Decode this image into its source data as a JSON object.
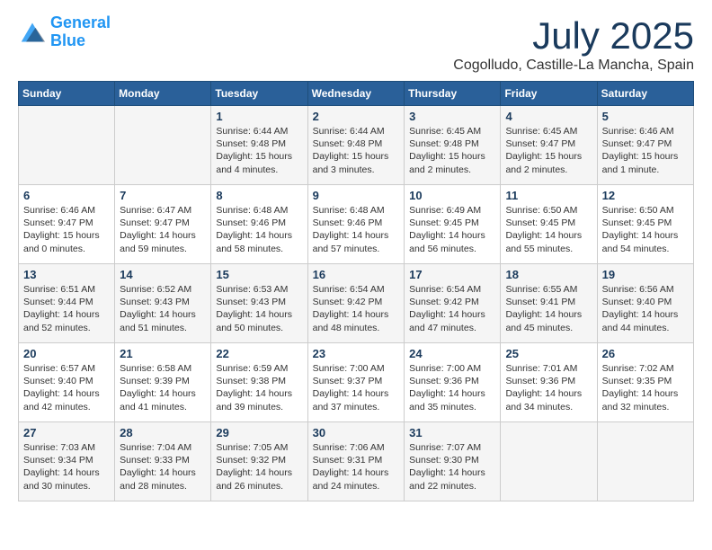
{
  "logo": {
    "line1": "General",
    "line2": "Blue"
  },
  "title": "July 2025",
  "location": "Cogolludo, Castille-La Mancha, Spain",
  "header_days": [
    "Sunday",
    "Monday",
    "Tuesday",
    "Wednesday",
    "Thursday",
    "Friday",
    "Saturday"
  ],
  "weeks": [
    [
      {
        "num": "",
        "info": ""
      },
      {
        "num": "",
        "info": ""
      },
      {
        "num": "1",
        "info": "Sunrise: 6:44 AM\nSunset: 9:48 PM\nDaylight: 15 hours\nand 4 minutes."
      },
      {
        "num": "2",
        "info": "Sunrise: 6:44 AM\nSunset: 9:48 PM\nDaylight: 15 hours\nand 3 minutes."
      },
      {
        "num": "3",
        "info": "Sunrise: 6:45 AM\nSunset: 9:48 PM\nDaylight: 15 hours\nand 2 minutes."
      },
      {
        "num": "4",
        "info": "Sunrise: 6:45 AM\nSunset: 9:47 PM\nDaylight: 15 hours\nand 2 minutes."
      },
      {
        "num": "5",
        "info": "Sunrise: 6:46 AM\nSunset: 9:47 PM\nDaylight: 15 hours\nand 1 minute."
      }
    ],
    [
      {
        "num": "6",
        "info": "Sunrise: 6:46 AM\nSunset: 9:47 PM\nDaylight: 15 hours\nand 0 minutes."
      },
      {
        "num": "7",
        "info": "Sunrise: 6:47 AM\nSunset: 9:47 PM\nDaylight: 14 hours\nand 59 minutes."
      },
      {
        "num": "8",
        "info": "Sunrise: 6:48 AM\nSunset: 9:46 PM\nDaylight: 14 hours\nand 58 minutes."
      },
      {
        "num": "9",
        "info": "Sunrise: 6:48 AM\nSunset: 9:46 PM\nDaylight: 14 hours\nand 57 minutes."
      },
      {
        "num": "10",
        "info": "Sunrise: 6:49 AM\nSunset: 9:45 PM\nDaylight: 14 hours\nand 56 minutes."
      },
      {
        "num": "11",
        "info": "Sunrise: 6:50 AM\nSunset: 9:45 PM\nDaylight: 14 hours\nand 55 minutes."
      },
      {
        "num": "12",
        "info": "Sunrise: 6:50 AM\nSunset: 9:45 PM\nDaylight: 14 hours\nand 54 minutes."
      }
    ],
    [
      {
        "num": "13",
        "info": "Sunrise: 6:51 AM\nSunset: 9:44 PM\nDaylight: 14 hours\nand 52 minutes."
      },
      {
        "num": "14",
        "info": "Sunrise: 6:52 AM\nSunset: 9:43 PM\nDaylight: 14 hours\nand 51 minutes."
      },
      {
        "num": "15",
        "info": "Sunrise: 6:53 AM\nSunset: 9:43 PM\nDaylight: 14 hours\nand 50 minutes."
      },
      {
        "num": "16",
        "info": "Sunrise: 6:54 AM\nSunset: 9:42 PM\nDaylight: 14 hours\nand 48 minutes."
      },
      {
        "num": "17",
        "info": "Sunrise: 6:54 AM\nSunset: 9:42 PM\nDaylight: 14 hours\nand 47 minutes."
      },
      {
        "num": "18",
        "info": "Sunrise: 6:55 AM\nSunset: 9:41 PM\nDaylight: 14 hours\nand 45 minutes."
      },
      {
        "num": "19",
        "info": "Sunrise: 6:56 AM\nSunset: 9:40 PM\nDaylight: 14 hours\nand 44 minutes."
      }
    ],
    [
      {
        "num": "20",
        "info": "Sunrise: 6:57 AM\nSunset: 9:40 PM\nDaylight: 14 hours\nand 42 minutes."
      },
      {
        "num": "21",
        "info": "Sunrise: 6:58 AM\nSunset: 9:39 PM\nDaylight: 14 hours\nand 41 minutes."
      },
      {
        "num": "22",
        "info": "Sunrise: 6:59 AM\nSunset: 9:38 PM\nDaylight: 14 hours\nand 39 minutes."
      },
      {
        "num": "23",
        "info": "Sunrise: 7:00 AM\nSunset: 9:37 PM\nDaylight: 14 hours\nand 37 minutes."
      },
      {
        "num": "24",
        "info": "Sunrise: 7:00 AM\nSunset: 9:36 PM\nDaylight: 14 hours\nand 35 minutes."
      },
      {
        "num": "25",
        "info": "Sunrise: 7:01 AM\nSunset: 9:36 PM\nDaylight: 14 hours\nand 34 minutes."
      },
      {
        "num": "26",
        "info": "Sunrise: 7:02 AM\nSunset: 9:35 PM\nDaylight: 14 hours\nand 32 minutes."
      }
    ],
    [
      {
        "num": "27",
        "info": "Sunrise: 7:03 AM\nSunset: 9:34 PM\nDaylight: 14 hours\nand 30 minutes."
      },
      {
        "num": "28",
        "info": "Sunrise: 7:04 AM\nSunset: 9:33 PM\nDaylight: 14 hours\nand 28 minutes."
      },
      {
        "num": "29",
        "info": "Sunrise: 7:05 AM\nSunset: 9:32 PM\nDaylight: 14 hours\nand 26 minutes."
      },
      {
        "num": "30",
        "info": "Sunrise: 7:06 AM\nSunset: 9:31 PM\nDaylight: 14 hours\nand 24 minutes."
      },
      {
        "num": "31",
        "info": "Sunrise: 7:07 AM\nSunset: 9:30 PM\nDaylight: 14 hours\nand 22 minutes."
      },
      {
        "num": "",
        "info": ""
      },
      {
        "num": "",
        "info": ""
      }
    ]
  ]
}
